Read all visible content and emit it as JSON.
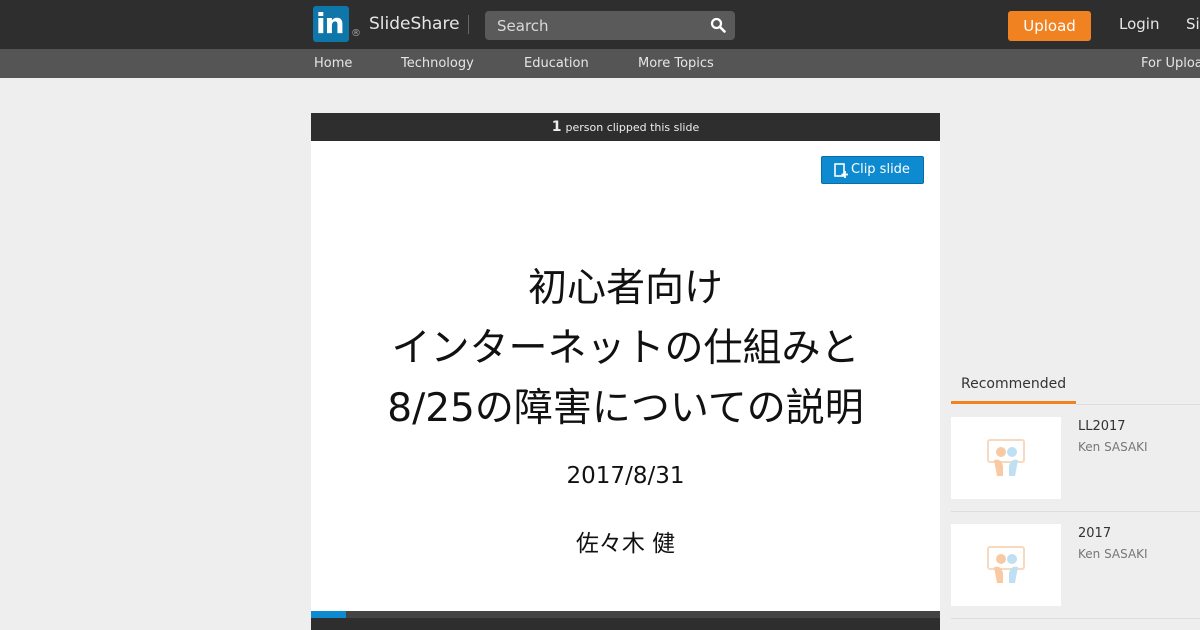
{
  "header": {
    "logo_text": "in",
    "logo_reg": "®",
    "brand": "SlideShare",
    "search_placeholder": "Search",
    "upload_label": "Upload",
    "login_label": "Login",
    "signup_label": "Signup"
  },
  "nav": {
    "items": [
      "Home",
      "Technology",
      "Education",
      "More Topics"
    ],
    "right_label": "For Uploaders"
  },
  "player": {
    "clip_count": "1",
    "clip_text": "person clipped this slide",
    "clip_button": "Clip slide",
    "progress": 0.055,
    "slide": {
      "title_lines": [
        "初心者向け",
        "インターネットの仕組みと",
        "8/25の障害についての説明"
      ],
      "date": "2017/8/31",
      "author": "佐々木 健"
    }
  },
  "recommended": {
    "tab_label": "Recommended",
    "items": [
      {
        "title": "LL2017",
        "author": "Ken SASAKI"
      },
      {
        "title": "2017",
        "author": "Ken SASAKI"
      }
    ]
  },
  "colors": {
    "topbar": "#2e2e2e",
    "navbar": "#555555",
    "upload": "#f08221",
    "linkedin_blue": "#0e76a8",
    "clip_blue": "#0e8bd0"
  },
  "icons": [
    "search-icon",
    "clip-icon",
    "slideshare-placeholder-icon"
  ]
}
